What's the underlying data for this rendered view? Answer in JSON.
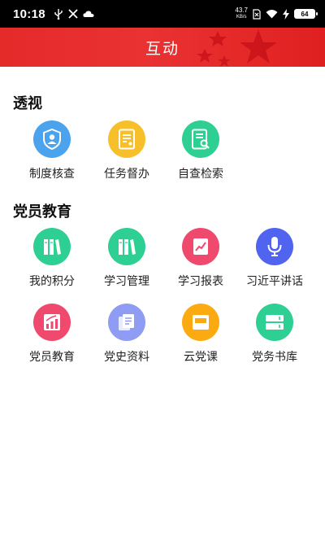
{
  "status_bar": {
    "time": "10:18",
    "net_speed_value": "43.7",
    "net_speed_unit": "KB/s",
    "battery_level": "64",
    "left_icons": [
      "usb-icon",
      "tools-icon",
      "cloud-icon"
    ],
    "right_icons": [
      "net-speed-indicator",
      "no-sim-icon",
      "wifi-icon",
      "charging-icon",
      "battery-icon"
    ]
  },
  "header": {
    "title": "互动",
    "background_color": "#e52a2a",
    "star_color": "#c9131a"
  },
  "sections": [
    {
      "title": "透视",
      "items": [
        {
          "label": "制度核查",
          "icon": "shield-user-icon",
          "color": "#4aa3ec"
        },
        {
          "label": "任务督办",
          "icon": "document-icon",
          "color": "#f7c02b"
        },
        {
          "label": "自查检索",
          "icon": "document-search-icon",
          "color": "#2ecf93"
        }
      ]
    },
    {
      "title": "党员教育",
      "items": [
        {
          "label": "我的积分",
          "icon": "books-icon",
          "color": "#2ecf93"
        },
        {
          "label": "学习管理",
          "icon": "books-icon",
          "color": "#2ecf93"
        },
        {
          "label": "学习报表",
          "icon": "chart-report-icon",
          "color": "#ef4a6d"
        },
        {
          "label": "习近平讲话",
          "icon": "microphone-icon",
          "color": "#5164f0"
        },
        {
          "label": "党员教育",
          "icon": "bar-chart-icon",
          "color": "#ef4a6d"
        },
        {
          "label": "党史资料",
          "icon": "copy-documents-icon",
          "color": "#8e9cf4"
        },
        {
          "label": "云党课",
          "icon": "folder-icon",
          "color": "#fbaa12"
        },
        {
          "label": "党务书库",
          "icon": "book-stack-icon",
          "color": "#2ecf93"
        }
      ]
    }
  ]
}
